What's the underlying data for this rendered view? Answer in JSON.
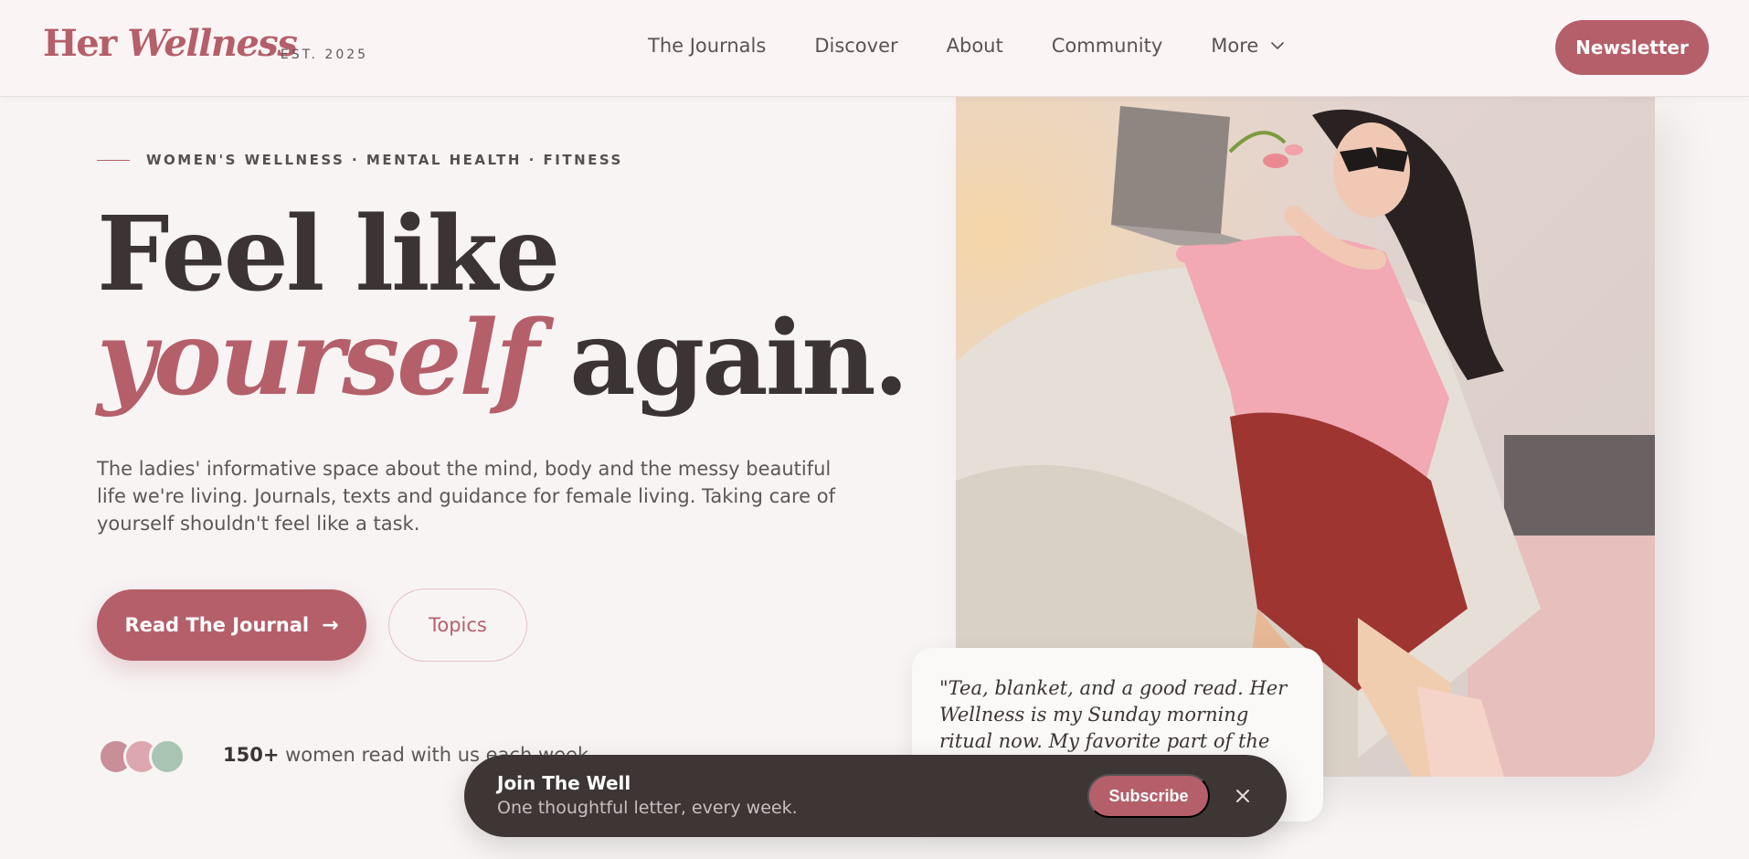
{
  "brand": {
    "logo_part1": "Her",
    "logo_part2": "Wellness",
    "established": "· EST. 2025",
    "accent_color": "#b55f6a",
    "dark_color": "#3e3535"
  },
  "nav": {
    "items": [
      {
        "label": "The Journals"
      },
      {
        "label": "Discover"
      },
      {
        "label": "About"
      },
      {
        "label": "Community"
      },
      {
        "label": "More",
        "icon": "chevron-down-icon"
      }
    ],
    "newsletter_label": "Newsletter"
  },
  "hero": {
    "eyebrow": "WOMEN'S WELLNESS · MENTAL HEALTH · FITNESS",
    "headline_line1": "Feel like",
    "headline_accent": "yourself",
    "headline_end": "again.",
    "lead": "The ladies' informative space about the mind, body and the messy beautiful life we're living. Journals, texts and guidance for female living. Taking care of yourself shouldn't feel like a task.",
    "primary_button": "Read The Journal",
    "primary_button_icon": "→",
    "secondary_button": "Topics",
    "reader_count": "150+",
    "reader_text": "women read with us each week",
    "avatar_colors": [
      "#c98f99",
      "#dca7ae",
      "#a9c4b3"
    ]
  },
  "quote": {
    "text": "\"Tea, blanket, and a good read. Her Wellness is my Sunday morning ritual now. My favorite part of the week.\""
  },
  "join_bar": {
    "title": "Join The Well",
    "subtitle": "One thoughtful letter, every week.",
    "subscribe_label": "Subscribe",
    "close_icon": "close-icon"
  }
}
